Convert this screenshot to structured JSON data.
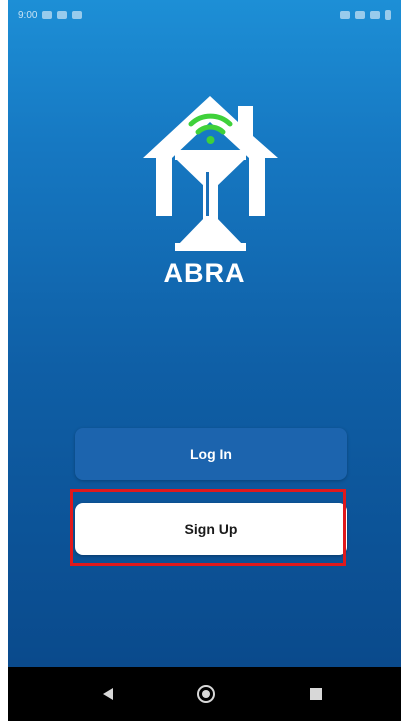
{
  "status_bar": {
    "time": "9:00"
  },
  "brand": {
    "name": "ABRA"
  },
  "buttons": {
    "login_label": "Log In",
    "signup_label": "Sign Up"
  },
  "nav_bar": {
    "back_icon": "back-triangle-icon",
    "home_icon": "home-circle-icon",
    "recents_icon": "recents-square-icon"
  },
  "colors": {
    "background_top": "#1d8fd6",
    "background_bottom": "#0a4a8c",
    "login_button": "#1c64ae",
    "signup_button": "#ffffff",
    "highlight_box": "#e0191c",
    "wifi_green": "#3fd13a"
  }
}
